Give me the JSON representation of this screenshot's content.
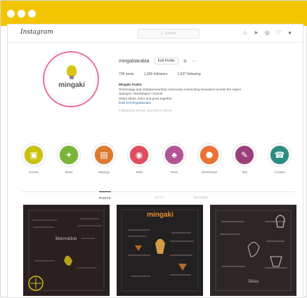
{
  "window": {
    "traffic_lights": [
      "close",
      "minimize",
      "zoom"
    ],
    "titlebar_color": "#f2c500"
  },
  "nav": {
    "logo": "Instagram",
    "search_placeholder": "Search",
    "icons": [
      "home-icon",
      "send-icon",
      "compass-icon",
      "heart-icon",
      "profile-icon"
    ]
  },
  "profile": {
    "avatar_text": "mingaki",
    "username": "mingakiarabia",
    "edit_button": "Edit Profile",
    "stats": [
      "728 posts",
      "1,906 followers",
      "1,037 following"
    ],
    "bio_name": "Mingaki Arabia",
    "bio_lines": [
      "Technology and entrepreneurship community connecting innovators across the region",
      "Startups • Workshops • Events",
      "Share ideas, learn and grow together"
    ],
    "bio_link": "linktr.ee/mingakiarabia",
    "followed_by": "Followed by ahmed, sara and 12 others"
  },
  "highlights": [
    {
      "label": "Events",
      "color": "#c9c20c",
      "icon": "calendar-icon"
    },
    {
      "label": "Ideas",
      "color": "#79b537",
      "icon": "bulb-icon"
    },
    {
      "label": "Startups",
      "color": "#df7a2d",
      "icon": "briefcase-icon"
    },
    {
      "label": "Talks",
      "color": "#e04d60",
      "icon": "speaker-icon"
    },
    {
      "label": "Team",
      "color": "#b35595",
      "icon": "team-icon"
    },
    {
      "label": "Workshops",
      "color": "#ea7236",
      "icon": "workshop-icon"
    },
    {
      "label": "Tips",
      "color": "#9b3f7c",
      "icon": "pen-icon"
    },
    {
      "label": "Contact",
      "color": "#2b8c81",
      "icon": "phone-icon"
    }
  ],
  "tabs": [
    {
      "label": "POSTS",
      "active": true
    },
    {
      "label": "IGTV",
      "active": false
    },
    {
      "label": "TAGGED",
      "active": false
    }
  ],
  "posts": [
    {
      "title": "Innovation",
      "accent": "#d9c317",
      "background": "#2a2020"
    },
    {
      "title": "mingaki",
      "accent": "#e98a2d",
      "background": "#232021"
    },
    {
      "title": "Ideas",
      "accent": "#ccb7b7",
      "background": "#2c2726"
    }
  ]
}
